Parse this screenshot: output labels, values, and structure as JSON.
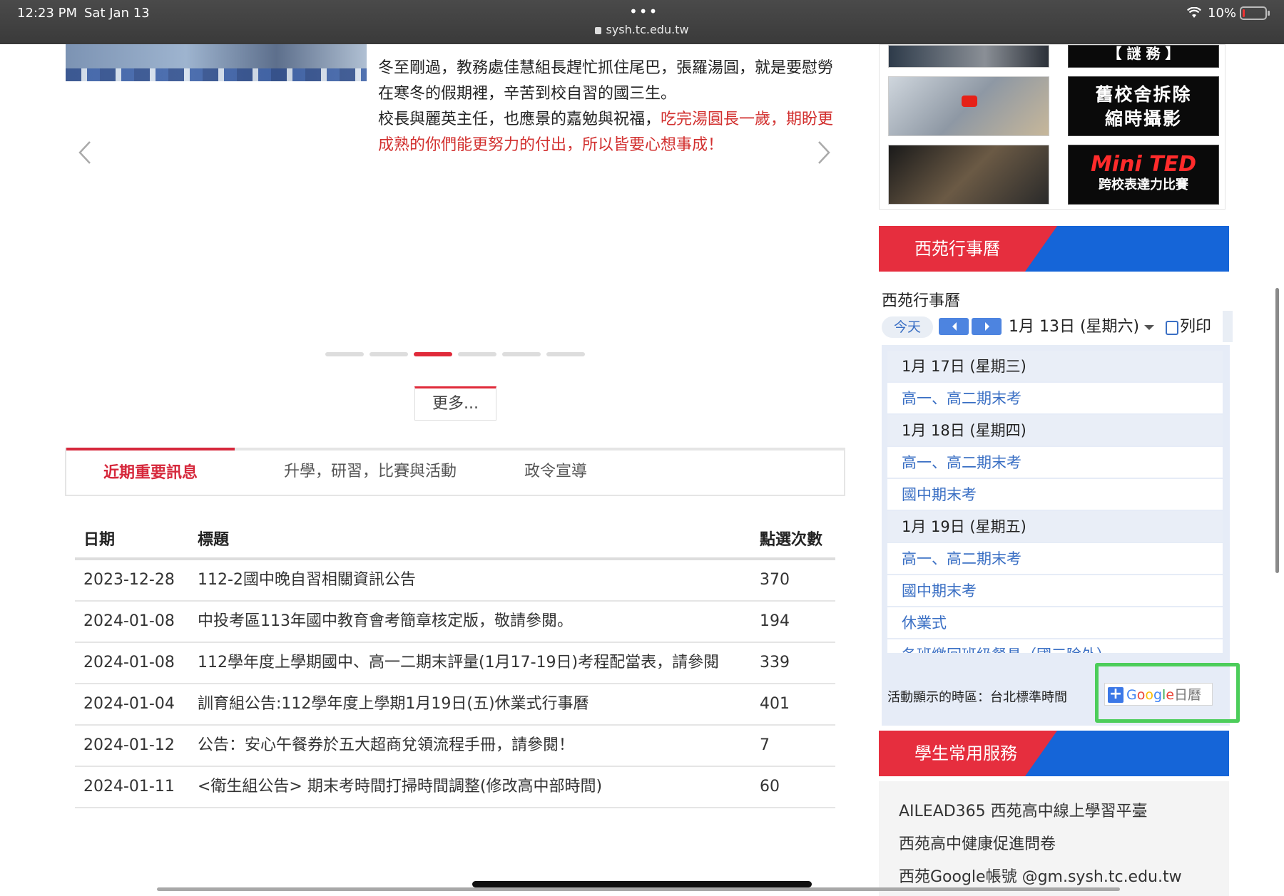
{
  "status": {
    "time": "12:23 PM",
    "date": "Sat Jan 13",
    "url": "sysh.tc.edu.tw",
    "battery": "10%",
    "battery_level": 0.1
  },
  "news": {
    "line1": "冬至剛過，教務處佳慧組長趕忙抓住尾巴，張羅湯圓，就是要慰勞在寒冬的假期裡，辛苦到校自習的國三生。",
    "line2_plain": "校長與麗英主任，也應景的嘉勉與祝福，",
    "line2_red": "吃完湯圓長一歲，期盼更成熟的你們能更努力的付出，所以皆要心想事成！",
    "more_label": "更多..."
  },
  "carousel": {
    "slide_count": 6,
    "active_index": 2
  },
  "tabs": [
    {
      "label": "近期重要訊息",
      "active": true
    },
    {
      "label": "升學，研習，比賽與活動",
      "active": false
    },
    {
      "label": "政令宣導",
      "active": false
    }
  ],
  "table": {
    "headers": [
      "日期",
      "標題",
      "點選次數"
    ],
    "rows": [
      {
        "date": "2023-12-28",
        "title": "112-2國中晚自習相關資訊公告",
        "count": "370"
      },
      {
        "date": "2024-01-08",
        "title": "中投考區113年國中教育會考簡章核定版，敬請參閱。",
        "count": "194"
      },
      {
        "date": "2024-01-08",
        "title": "112學年度上學期國中、高一二期末評量(1月17-19日)考程配當表，請參閱",
        "count": "339"
      },
      {
        "date": "2024-01-04",
        "title": "訓育組公告:112學年度上學期1月19日(五)休業式行事曆",
        "count": "401"
      },
      {
        "date": "2024-01-12",
        "title": "公告：安心午餐券於五大超商兌領流程手冊，請參閱！",
        "count": "7"
      },
      {
        "date": "2024-01-11",
        "title": "<衛生組公告> 期末考時間打掃時間調整(修改高中部時間)",
        "count": "60"
      }
    ]
  },
  "videos": {
    "btn1": "【 謎 務 】",
    "btn2_line1": "舊校舍拆除",
    "btn2_line2": "縮時攝影",
    "btn3_big": "Mini TED",
    "btn3_small": "跨校表達力比賽"
  },
  "calendar": {
    "section_title": "西苑行事曆",
    "widget_title": "西苑行事曆",
    "today_label": "今天",
    "date_label": "1月 13日 (星期六)",
    "print_label": "列印",
    "rows": [
      {
        "kind": "day",
        "text": "1月 17日 (星期三)"
      },
      {
        "kind": "event",
        "text": "高一、高二期末考"
      },
      {
        "kind": "day",
        "text": "1月 18日 (星期四)"
      },
      {
        "kind": "event",
        "text": "高一、高二期末考"
      },
      {
        "kind": "event",
        "text": "國中期末考"
      },
      {
        "kind": "day",
        "text": "1月 19日 (星期五)"
      },
      {
        "kind": "event",
        "text": "高一、高二期末考"
      },
      {
        "kind": "event",
        "text": "國中期末考"
      },
      {
        "kind": "event",
        "text": "休業式"
      },
      {
        "kind": "event",
        "text": "各班繳回班級餐具（國三除外）"
      }
    ],
    "timezone_text": "活動顯示的時區：台北標準時間",
    "gcal_plus": "+",
    "gcal_google": "Google",
    "gcal_suffix": "日曆"
  },
  "services": {
    "section_title": "學生常用服務",
    "items": [
      "AILEAD365 西苑高中線上學習平臺",
      "西苑高中健康促進問卷",
      "西苑Google帳號 @gm.sysh.tc.edu.tw"
    ]
  }
}
